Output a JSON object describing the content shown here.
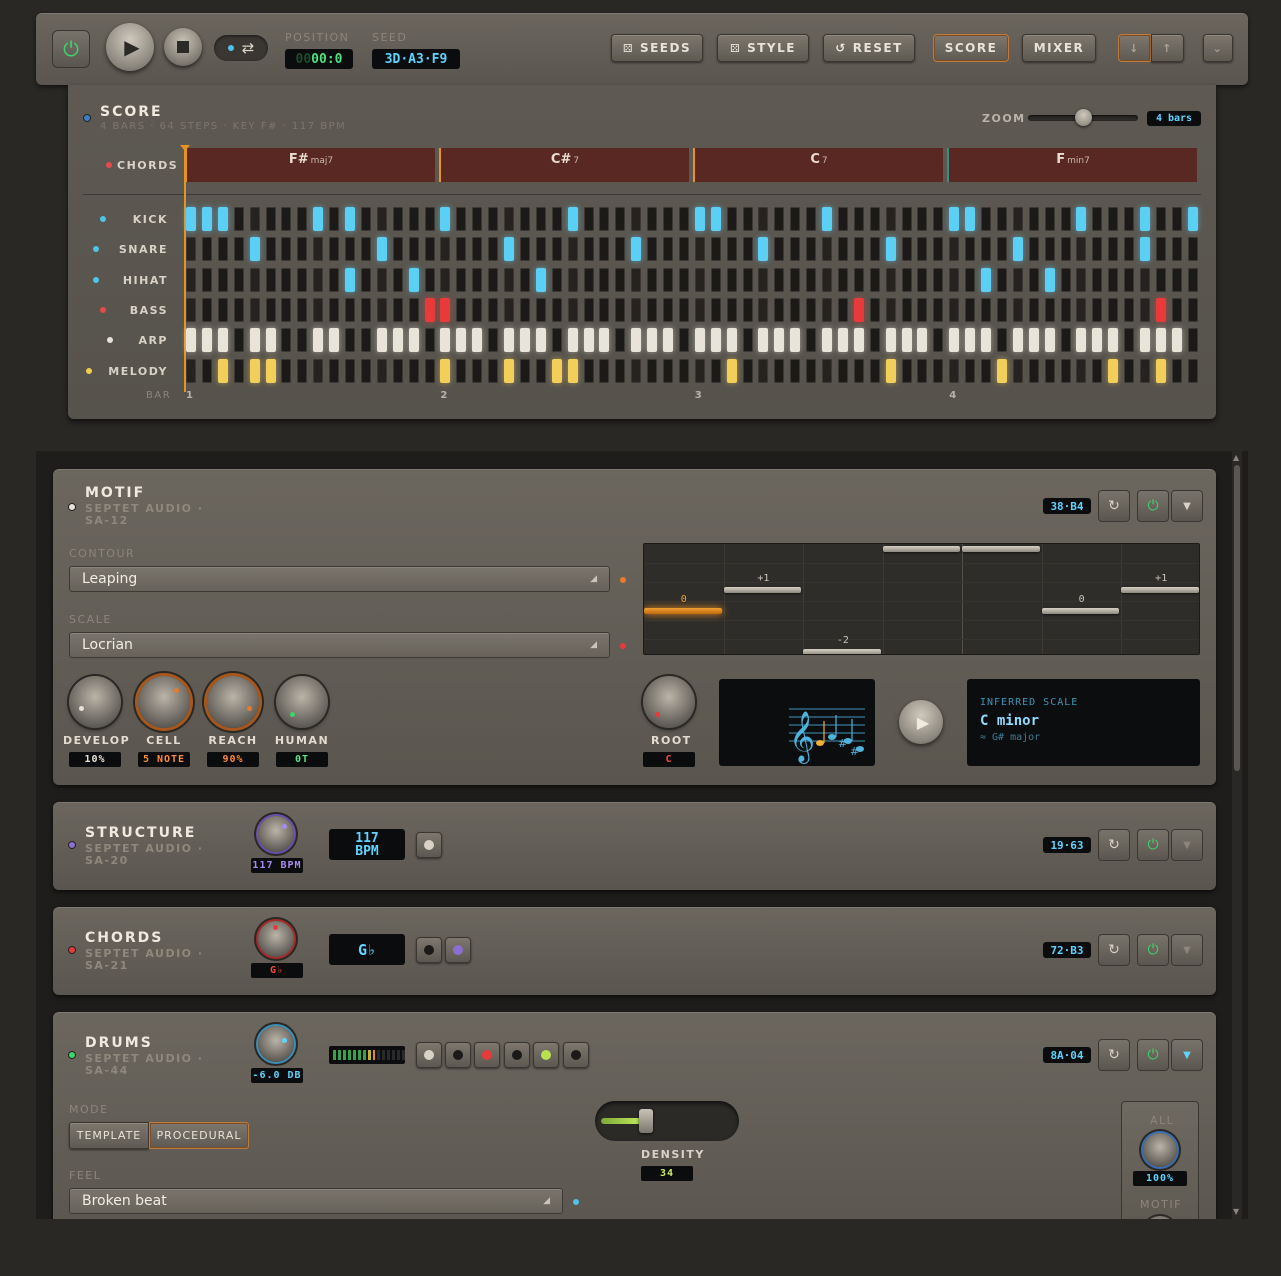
{
  "transport": {
    "position_label": "POSITION",
    "position_value_dim": "00",
    "position_value": "00:0",
    "seed_label": "SEED",
    "seed_value": "3D·A3·F9",
    "seeds_label": "SEEDS",
    "style_label": "STYLE",
    "reset_label": "RESET",
    "score_label": "SCORE",
    "mixer_label": "MIXER",
    "down_arrow": "↓",
    "up_arrow": "↑",
    "collapse_arrow": "⌄"
  },
  "score": {
    "title": "SCORE",
    "subtitle": "4 BARS · 64 STEPS · KEY F# · 117 BPM",
    "zoom_label": "ZOOM",
    "zoom_value": "4 bars",
    "zoom_level": 0.5,
    "chords_label": "CHORDS",
    "chords": [
      {
        "root": "F#",
        "quality": "maj7"
      },
      {
        "root": "C#",
        "quality": "7"
      },
      {
        "root": "C",
        "quality": "7"
      },
      {
        "root": "F",
        "quality": "min7"
      }
    ],
    "bar_label": "BAR",
    "bars": [
      "1",
      "2",
      "3",
      "4"
    ],
    "tracks": [
      {
        "name": "KICK",
        "dot": "#4fc3e8",
        "color": "#5ccff5",
        "steps": [
          0,
          1,
          2,
          8,
          10,
          16,
          24,
          32,
          33,
          40,
          48,
          49,
          56,
          60,
          63
        ]
      },
      {
        "name": "SNARE",
        "dot": "#4fc3e8",
        "color": "#5ccff5",
        "steps": [
          4,
          12,
          20,
          28,
          36,
          44,
          52,
          60
        ]
      },
      {
        "name": "HIHAT",
        "dot": "#4fc3e8",
        "color": "#5ccff5",
        "steps": [
          10,
          14,
          22,
          50,
          54
        ]
      },
      {
        "name": "BASS",
        "dot": "#e84a4a",
        "color": "#e83a3a",
        "steps": [
          15,
          16,
          42,
          61
        ]
      },
      {
        "name": "ARP",
        "dot": "#e8e3d8",
        "color": "#e8e4da",
        "steps": [
          0,
          1,
          2,
          4,
          5,
          8,
          9,
          12,
          13,
          14,
          16,
          17,
          18,
          20,
          21,
          22,
          24,
          25,
          26,
          28,
          29,
          30,
          32,
          33,
          34,
          36,
          37,
          38,
          40,
          41,
          42,
          44,
          45,
          46,
          48,
          49,
          50,
          52,
          53,
          54,
          56,
          57,
          58,
          60,
          61,
          62
        ]
      },
      {
        "name": "MELODY",
        "dot": "#f2cf4a",
        "color": "#f2cf5a",
        "steps": [
          2,
          4,
          5,
          16,
          20,
          23,
          24,
          34,
          44,
          51,
          58,
          61
        ]
      }
    ]
  },
  "motif": {
    "title": "MOTIF",
    "subtitle": "SEPTET AUDIO · SA-12",
    "code": "38·B4",
    "contour_label": "CONTOUR",
    "contour_value": "Leaping",
    "scale_label": "SCALE",
    "scale_value": "Locrian",
    "notes": [
      {
        "label": "0",
        "level": 0
      },
      {
        "label": "+1",
        "level": 1
      },
      {
        "label": "-2",
        "level": -2
      },
      {
        "label": "",
        "level": 4
      },
      {
        "label": "",
        "level": 4
      },
      {
        "label": "0",
        "level": 0
      },
      {
        "label": "+1",
        "level": 1
      }
    ],
    "knobs": [
      {
        "name": "DEVELOP",
        "value": "10%"
      },
      {
        "name": "CELL",
        "value": "5 NOTE"
      },
      {
        "name": "REACH",
        "value": "90%"
      },
      {
        "name": "HUMAN",
        "value": "0T"
      }
    ],
    "root_label": "ROOT",
    "root_value": "C",
    "inferred_label": "INFERRED SCALE",
    "inferred_value": "C minor",
    "inferred_alt": "≈ G# major"
  },
  "structure": {
    "title": "STRUCTURE",
    "subtitle": "SEPTET AUDIO · SA-20",
    "knob_value": "117 BPM",
    "lcd_line1": "117",
    "lcd_line2": "BPM",
    "code": "19·63"
  },
  "chords_module": {
    "title": "CHORDS",
    "subtitle": "SEPTET AUDIO · SA-21",
    "knob_value": "G♭",
    "lcd_value": "G♭",
    "code": "72·B3"
  },
  "drums": {
    "title": "DRUMS",
    "subtitle": "SEPTET AUDIO · SA-44",
    "knob_value": "-6.0 DB",
    "code": "8A·04",
    "mode_label": "MODE",
    "mode_template": "TEMPLATE",
    "mode_procedural": "PROCEDURAL",
    "feel_label": "FEEL",
    "feel_value": "Broken beat",
    "density_label": "DENSITY",
    "density_value": "34",
    "all_label": "ALL",
    "all_value": "100%",
    "motif_label": "MOTIF"
  }
}
